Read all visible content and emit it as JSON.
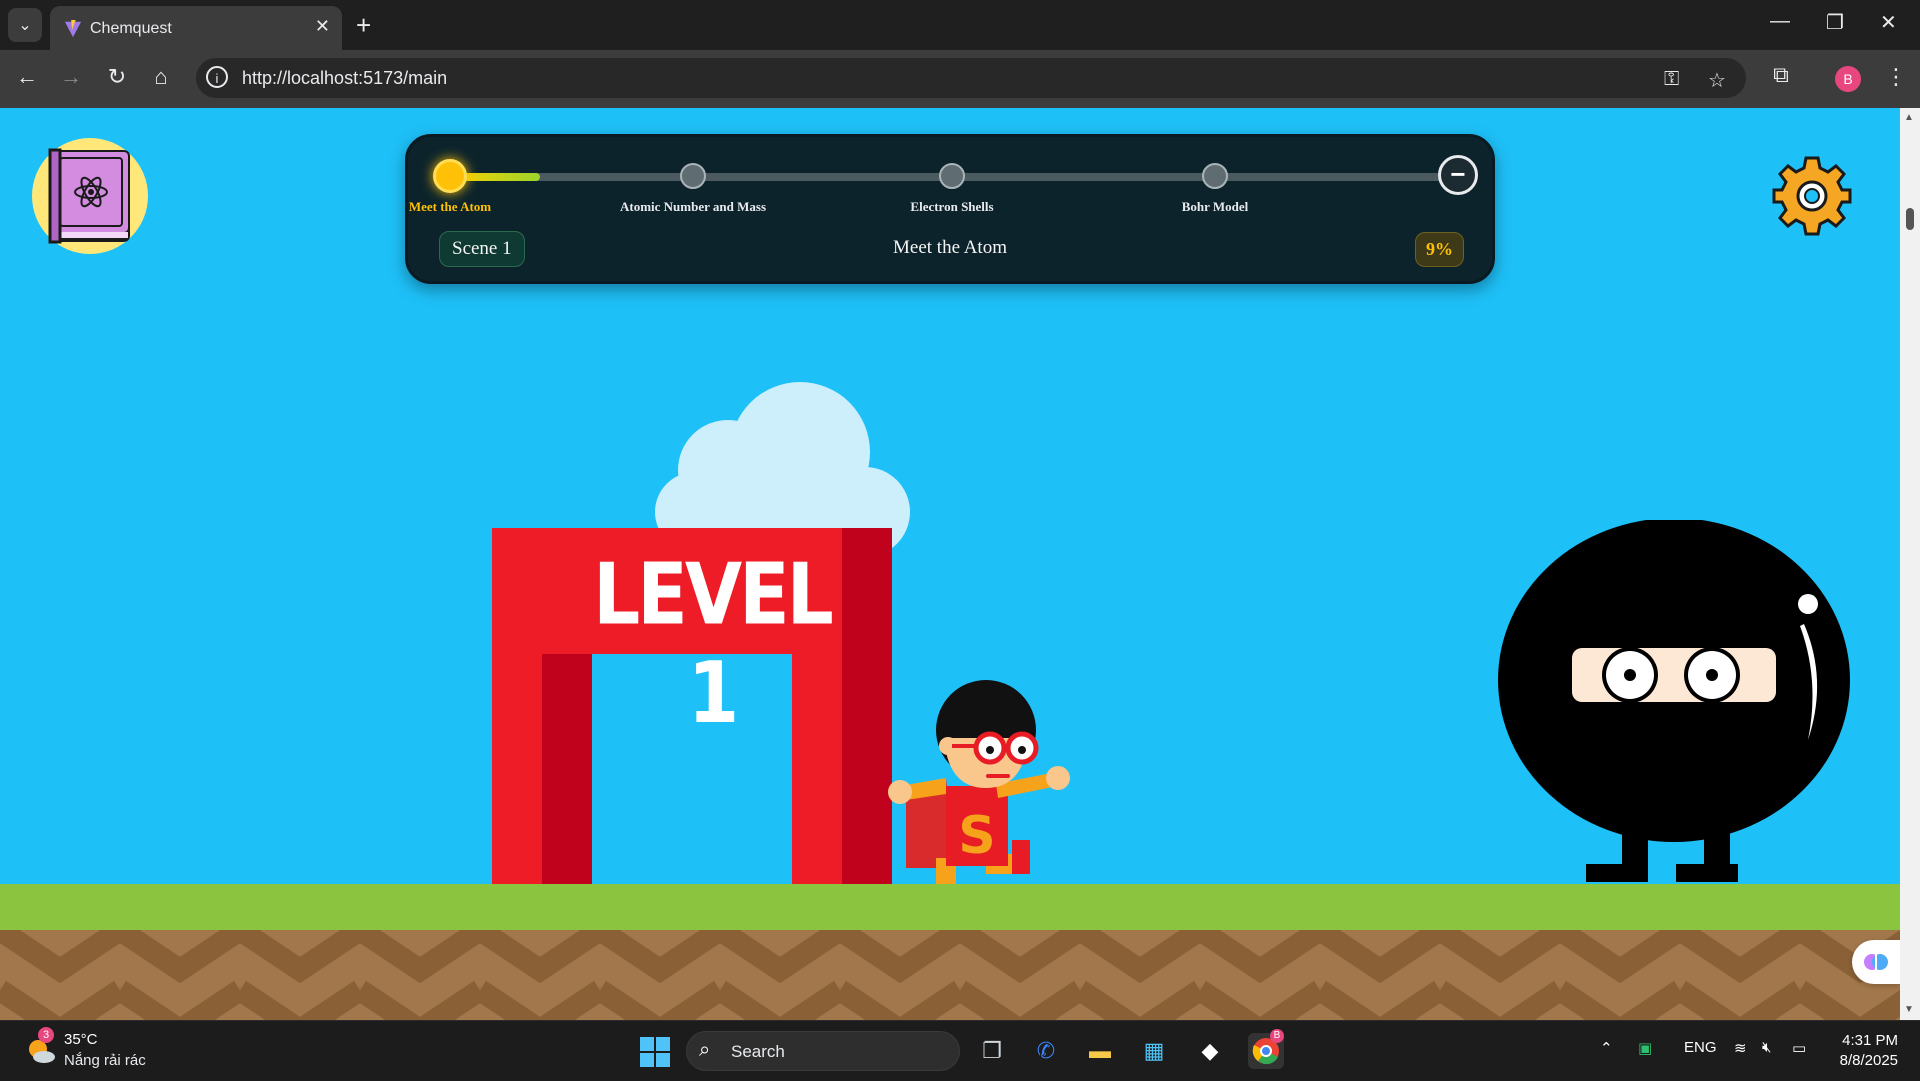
{
  "browser": {
    "tab_title": "Chemquest",
    "tab_close": "✕",
    "new_tab": "+",
    "tab_menu": "⌄",
    "url": "http://localhost:5173/main",
    "profile_initial": "B",
    "controls": {
      "minimize": "—",
      "restore": "❐",
      "close": "✕"
    }
  },
  "game": {
    "progress": {
      "steps": [
        {
          "label": "Meet the Atom",
          "active": true
        },
        {
          "label": "Atomic Number and Mass",
          "active": false
        },
        {
          "label": "Electron Shells",
          "active": false
        },
        {
          "label": "Bohr Model",
          "active": false
        }
      ],
      "end_symbol": "−",
      "scene": "Scene 1",
      "scene_title": "Meet the Atom",
      "percent_label": "9%",
      "percent": 9
    },
    "gate_text": "LEVEL 1",
    "hero_emblem": "S",
    "colors": {
      "sky": "#1ec0f8",
      "grass": "#8bc43f",
      "dirt": "#a2774b",
      "gate": "#ee1c27",
      "gate_shadow": "#c0021d",
      "accent": "#ffc107"
    }
  },
  "taskbar": {
    "weather_badge": "3",
    "weather_temp": "35°C",
    "weather_desc": "Nắng rải rác",
    "search_label": "Search",
    "chrome_badge": "B",
    "language": "ENG",
    "time": "4:31 PM",
    "date": "8/8/2025"
  }
}
